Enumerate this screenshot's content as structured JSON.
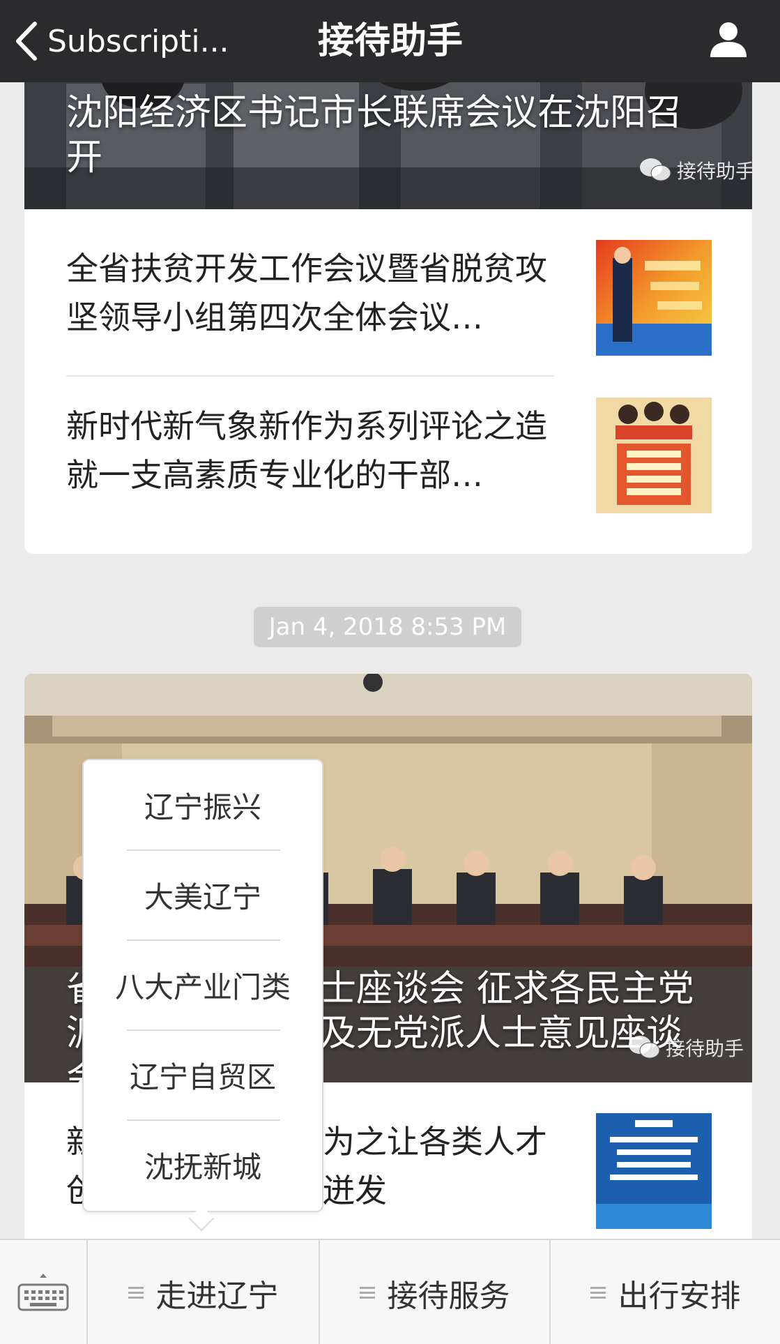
{
  "nav": {
    "back_label": "Subscripti...",
    "title": "接待助手"
  },
  "feed": {
    "card1": {
      "cover_title": "沈阳经济区书记市长联席会议在沈阳召开",
      "watermark": "接待助手",
      "articles": [
        {
          "title": "全省扶贫开发工作会议暨省脱贫攻坚领导小组第四次全体会议…"
        },
        {
          "title": "新时代新气象新作为系列评论之造就一支高素质专业化的干部…"
        }
      ]
    },
    "timestamp": "Jan 4, 2018 8:53 PM",
    "card2": {
      "cover_title": "省委召开党外人士座谈会 征求各民主党派工商联负责人及无党派人士意见座谈会",
      "watermark": "接待助手",
      "articles": [
        {
          "title": "新时代新气象新作为之让各类人才创新创造活力竞相迸发"
        }
      ]
    }
  },
  "popup_menu": {
    "items": [
      "辽宁振兴",
      "大美辽宁",
      "八大产业门类",
      "辽宁自贸区",
      "沈抚新城"
    ]
  },
  "bottom_menu": {
    "items": [
      "走进辽宁",
      "接待服务",
      "出行安排"
    ]
  }
}
